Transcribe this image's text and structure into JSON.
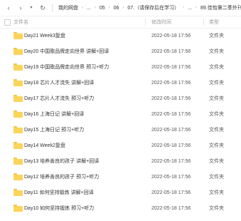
{
  "toolbar": {
    "back_icon": "chevron-left-icon",
    "forward_icon": "chevron-right-icon",
    "dropdown_icon": "chevron-down-icon",
    "refresh_icon": "refresh-icon",
    "breadcrumbs": [
      "我的网盘",
      "...",
      "05",
      "06",
      "07.（请保存后在学习）",
      "...",
      "89.佳怡第二季外刊营"
    ]
  },
  "header": {
    "name": "文件名",
    "modified": "修改时间",
    "type": "类型"
  },
  "files": [
    {
      "name": "Day21 Week3复盘",
      "modified": "2022-05-18 17:56",
      "type": "文件夹"
    },
    {
      "name": "Day20 中国歌品牌走向世界 讲解+回译",
      "modified": "2022-05-18 17:56",
      "type": "文件夹"
    },
    {
      "name": "Day19 中国歌品牌走向世界 预习+听力",
      "modified": "2022-05-18 17:56",
      "type": "文件夹"
    },
    {
      "name": "Day18 芯片人才流失 讲解+回译",
      "modified": "2022-05-18 17:56",
      "type": "文件夹"
    },
    {
      "name": "Day17 芯片人才流失 预习+听力",
      "modified": "2022-05-18 17:56",
      "type": "文件夹"
    },
    {
      "name": "Day16 上海日记 讲解+回译",
      "modified": "2022-05-18 17:56",
      "type": "文件夹"
    },
    {
      "name": "Day15 上海日记 预习+听力",
      "modified": "2022-05-18 17:56",
      "type": "文件夹"
    },
    {
      "name": "Day14 Week2复盘",
      "modified": "2022-05-18 17:56",
      "type": "文件夹"
    },
    {
      "name": "Day13 培养善良的孩子 讲解+回译",
      "modified": "2022-05-18 17:56",
      "type": "文件夹"
    },
    {
      "name": "Day12 培养善良的孩子 预习+听力",
      "modified": "2022-05-18 17:56",
      "type": "文件夹"
    },
    {
      "name": "Day11 如何坚持锻炼 讲解+回译",
      "modified": "2022-05-18 17:56",
      "type": "文件夹"
    },
    {
      "name": "Day10 如何坚持锻炼 预习+听力",
      "modified": "2022-05-18 17:56",
      "type": "文件夹"
    }
  ],
  "colors": {
    "folder": "#fbd45b",
    "folder_tab": "#f5c445",
    "header_text": "#999999"
  }
}
